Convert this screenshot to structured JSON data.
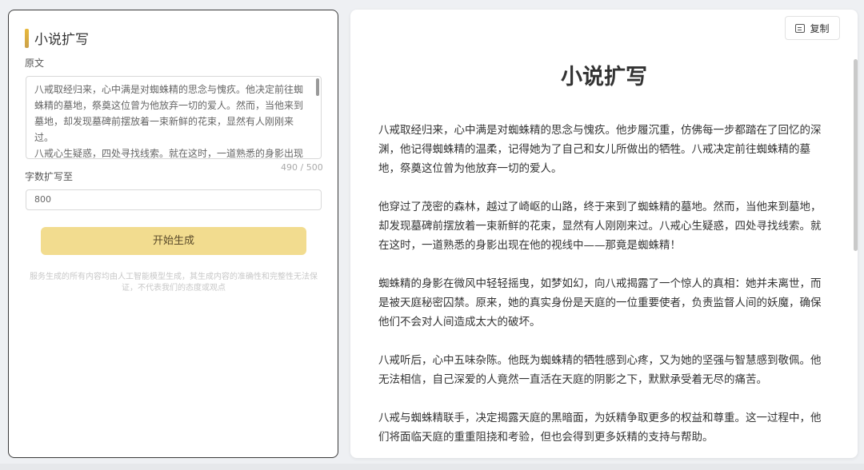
{
  "left": {
    "title": "小说扩写",
    "source_label": "原文",
    "source_text": [
      "八戒取经归来，心中满是对蜘蛛精的思念与愧疚。他决定前往蜘蛛精的墓地，祭奠这位曾为他放弃一切的爱人。然而，当他来到墓地，却发现墓碑前摆放着一束新鲜的花束，显然有人刚刚来过。",
      "八戒心生疑惑，四处寻找线索。就在这时，一道熟悉的身影出现"
    ],
    "char_count": "490 / 500",
    "expand_label": "字数扩写至",
    "expand_value": "800",
    "generate_button": "开始生成",
    "disclaimer": "服务生成的所有内容均由人工智能模型生成，其生成内容的准确性和完整性无法保证，不代表我们的态度或观点"
  },
  "right": {
    "copy_button": "复制",
    "title": "小说扩写",
    "paragraphs": [
      "八戒取经归来，心中满是对蜘蛛精的思念与愧疚。他步履沉重，仿佛每一步都踏在了回忆的深渊，他记得蜘蛛精的温柔，记得她为了自己和女儿所做出的牺牲。八戒决定前往蜘蛛精的墓地，祭奠这位曾为他放弃一切的爱人。",
      "他穿过了茂密的森林，越过了崎岖的山路，终于来到了蜘蛛精的墓地。然而，当他来到墓地，却发现墓碑前摆放着一束新鲜的花束，显然有人刚刚来过。八戒心生疑惑，四处寻找线索。就在这时，一道熟悉的身影出现在他的视线中——那竟是蜘蛛精！",
      "蜘蛛精的身影在微风中轻轻摇曳，如梦如幻，向八戒揭露了一个惊人的真相：她并未离世，而是被天庭秘密囚禁。原来，她的真实身份是天庭的一位重要使者，负责监督人间的妖魔，确保他们不会对人间造成太大的破坏。",
      "八戒听后，心中五味杂陈。他既为蜘蛛精的牺牲感到心疼，又为她的坚强与智慧感到敬佩。他无法相信，自己深爱的人竟然一直活在天庭的阴影之下，默默承受着无尽的痛苦。",
      "八戒与蜘蛛精联手，决定揭露天庭的黑暗面，为妖精争取更多的权益和尊重。这一过程中，他们将面临天庭的重重阻挠和考验，但也会得到更多妖精的支持与帮助。"
    ]
  }
}
